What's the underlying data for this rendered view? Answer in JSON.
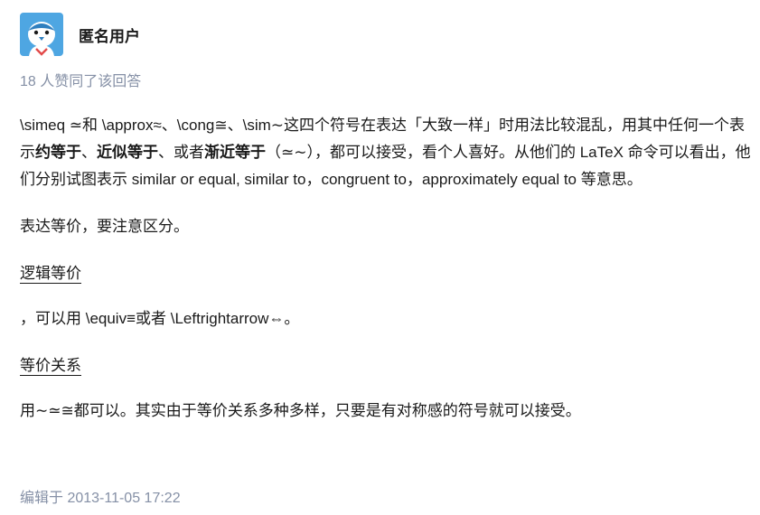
{
  "author": {
    "name": "匿名用户",
    "avatar_icon": "anonymous-bird-avatar-icon",
    "avatar_color": "#4ea6e2"
  },
  "votes_text": "18 人赞同了该回答",
  "content": {
    "p1": {
      "a": "\\simeq ≃和 \\approx≈、\\cong≅、\\sim∼这四个符号在表达「大致一样」时用法比较混乱，用其中任何一个表示",
      "b1": "约等于",
      "c": "、",
      "b2": "近似等于",
      "d": "、或者",
      "b3": "渐近等于",
      "e": "（≃∼），都可以接受，看个人喜好。从他们的 LaTeX 命令可以看出，他们分别试图表示 similar or equal, similar to，congruent to，approximately equal to 等意思。"
    },
    "p2": "表达等价，要注意区分。",
    "h1": "逻辑等价",
    "p3": "，可以用 \\equiv≡或者 \\Leftrightarrow⇔。",
    "h2": "等价关系",
    "p4": "用∼≃≅都可以。其实由于等价关系多种多样，只要是有对称感的符号就可以接受。"
  },
  "edit_time": "编辑于 2013-11-05 17:22",
  "colors": {
    "text": "#1a1a1a",
    "meta": "#8590a6"
  }
}
